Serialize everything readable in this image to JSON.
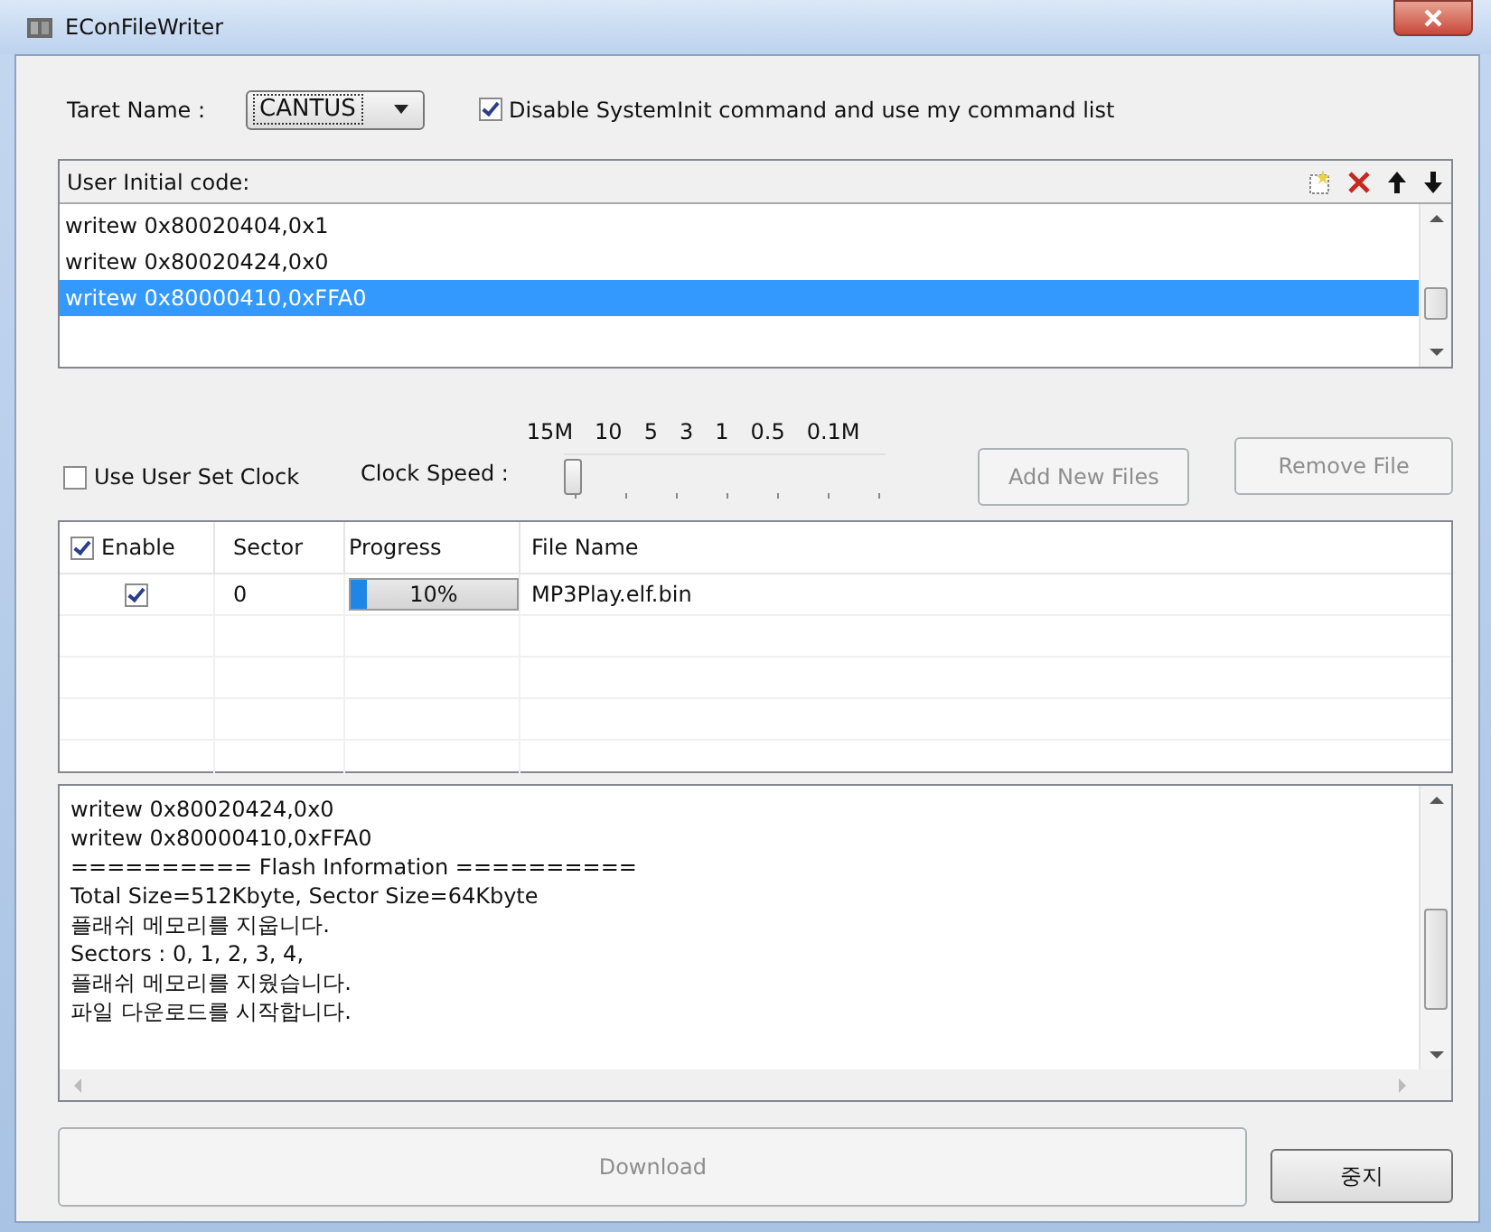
{
  "window": {
    "title": "EConFileWriter"
  },
  "target": {
    "label": "Taret Name :",
    "value": "CANTUS"
  },
  "disable_system_init": {
    "label": "Disable SystemInit command and use my command list",
    "checked": true
  },
  "user_initial_code": {
    "label": "User Initial code:",
    "items": [
      {
        "text": "writew 0x80020404,0x1",
        "selected": false
      },
      {
        "text": "writew 0x80020424,0x0",
        "selected": false
      },
      {
        "text": "writew 0x80000410,0xFFA0",
        "selected": true
      }
    ]
  },
  "clock": {
    "use_user_set_clock": {
      "label": "Use User Set Clock",
      "checked": false
    },
    "speed_label": "Clock Speed :",
    "tick_labels": [
      "15M",
      "10",
      "5",
      "3",
      "1",
      "0.5",
      "0.1M"
    ],
    "level": 0
  },
  "file_buttons": [
    {
      "label": "Add New Files",
      "disabled": true
    },
    {
      "label": "Remove File",
      "disabled": true
    }
  ],
  "file_table": {
    "header_checked": true,
    "columns": [
      "Enable",
      "Sector",
      "Progress",
      "File Name"
    ],
    "rows": [
      {
        "enabled": true,
        "sector": "0",
        "progress": {
          "level": 0.1,
          "text": "10%"
        },
        "file_name": "MP3Play.elf.bin"
      }
    ]
  },
  "log": {
    "lines": [
      "writew 0x80020424,0x0",
      "writew 0x80000410,0xFFA0",
      "========== Flash Information ==========",
      "Total Size=512Kbyte, Sector Size=64Kbyte",
      "플래쉬 메모리를 지웁니다.",
      "Sectors : 0, 1, 2, 3, 4,",
      "플래쉬 메모리를 지웠습니다.",
      "파일 다운로드를 시작합니다."
    ]
  },
  "download_button": {
    "label": "Download",
    "disabled": true
  },
  "stop_button": {
    "label": "중지",
    "disabled": false
  }
}
